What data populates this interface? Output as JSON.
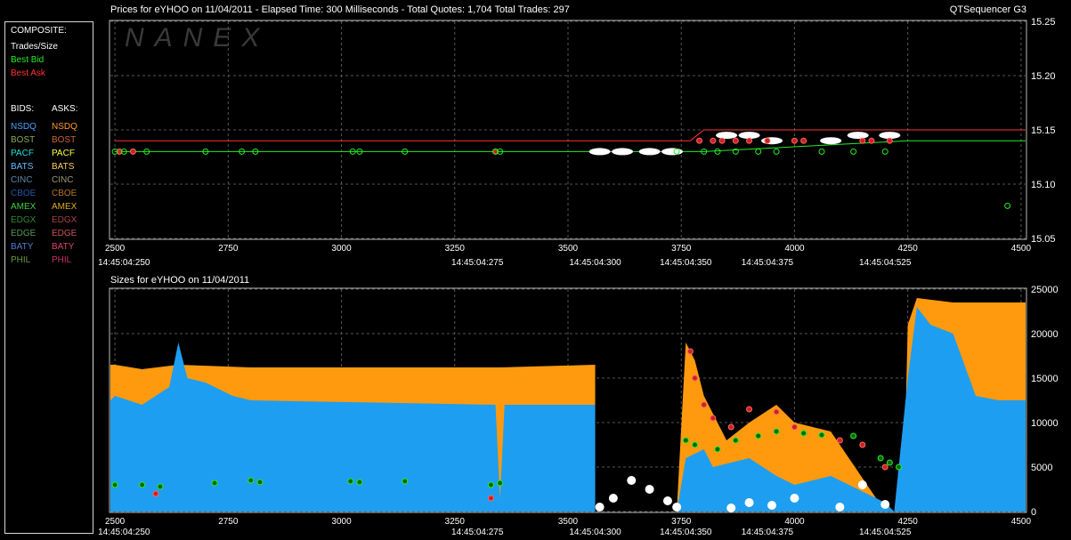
{
  "header": {
    "prices_title": "Prices for  eYHOO  on  11/04/2011  -  Elapsed Time: 300 Milliseconds  -  Total Quotes: 1,704  Total Trades: 297",
    "app_name": "QTSequencer G3",
    "sizes_title": "Sizes for  eYHOO  on  11/04/2011",
    "watermark": "NANEX"
  },
  "legend": {
    "composite_label": "COMPOSITE:",
    "composite_items": [
      {
        "label": "Trades/Size",
        "color": "#ffffff"
      },
      {
        "label": "Best Bid",
        "color": "#22ee22"
      },
      {
        "label": "Best Ask",
        "color": "#ff3333"
      }
    ],
    "bids_label": "BIDS:",
    "asks_label": "ASKS:",
    "exchanges": [
      {
        "label": "NSDQ",
        "bid_color": "#4aa0ff",
        "ask_color": "#ff9a30"
      },
      {
        "label": "BOST",
        "bid_color": "#88aa55",
        "ask_color": "#cc6633"
      },
      {
        "label": "PACF",
        "bid_color": "#22dddd",
        "ask_color": "#ffff44"
      },
      {
        "label": "BATS",
        "bid_color": "#66bbff",
        "ask_color": "#ffcc66"
      },
      {
        "label": "CINC",
        "bid_color": "#5a8aaa",
        "ask_color": "#999977"
      },
      {
        "label": "CBOE",
        "bid_color": "#2255aa",
        "ask_color": "#bb7722"
      },
      {
        "label": "AMEX",
        "bid_color": "#44cc44",
        "ask_color": "#ddaa22"
      },
      {
        "label": "EDGX",
        "bid_color": "#338833",
        "ask_color": "#aa4444"
      },
      {
        "label": "EDGE",
        "bid_color": "#559955",
        "ask_color": "#cc5555"
      },
      {
        "label": "BATY",
        "bid_color": "#5577cc",
        "ask_color": "#dd4466"
      },
      {
        "label": "PHIL",
        "bid_color": "#669944",
        "ask_color": "#cc3366"
      }
    ]
  },
  "chart_data": [
    {
      "type": "scatter",
      "title": "Prices for  eYHOO  on  11/04/2011",
      "x_ticks": [
        2500,
        2750,
        3000,
        3250,
        3500,
        3750,
        4000,
        4250,
        4500
      ],
      "x_range": [
        2490,
        4510
      ],
      "y_ticks": [
        "15.05",
        "15.10",
        "15.15",
        "15.20",
        "15.25"
      ],
      "y_range": [
        15.05,
        15.25
      ],
      "time_labels": [
        {
          "x": 2520,
          "label": "14:45:04:250"
        },
        {
          "x": 3300,
          "label": "14:45:04:275"
        },
        {
          "x": 3560,
          "label": "14:45:04:300"
        },
        {
          "x": 3760,
          "label": "14:45:04:350"
        },
        {
          "x": 3940,
          "label": "14:45:04:375"
        },
        {
          "x": 4200,
          "label": "14:45:04:525"
        }
      ],
      "series": [
        {
          "name": "Best Bid",
          "color": "#22ee22",
          "points": [
            [
              2500,
              15.13
            ],
            [
              3560,
              15.13
            ],
            [
              3560,
              15.13
            ],
            [
              3800,
              15.13
            ],
            [
              4250,
              15.14
            ],
            [
              4510,
              15.14
            ]
          ]
        },
        {
          "name": "Best Ask",
          "color": "#ff3333",
          "points": [
            [
              2500,
              15.14
            ],
            [
              3770,
              15.14
            ],
            [
              3800,
              15.15
            ],
            [
              4250,
              15.15
            ],
            [
              4510,
              15.15
            ]
          ]
        },
        {
          "name": "Trades/Size",
          "color": "#ffffff",
          "points": [
            [
              3570,
              15.13
            ],
            [
              3620,
              15.13
            ],
            [
              3680,
              15.13
            ],
            [
              3730,
              15.13
            ],
            [
              3850,
              15.145
            ],
            [
              3900,
              15.145
            ],
            [
              3950,
              15.14
            ],
            [
              4080,
              15.14
            ],
            [
              4140,
              15.145
            ],
            [
              4210,
              15.145
            ]
          ]
        }
      ],
      "bid_markers": [
        [
          2500,
          15.13
        ],
        [
          2520,
          15.13
        ],
        [
          2570,
          15.13
        ],
        [
          2700,
          15.13
        ],
        [
          2780,
          15.13
        ],
        [
          2810,
          15.13
        ],
        [
          3025,
          15.13
        ],
        [
          3040,
          15.13
        ],
        [
          3140,
          15.13
        ],
        [
          3340,
          15.13
        ],
        [
          3350,
          15.13
        ],
        [
          3740,
          15.13
        ],
        [
          3800,
          15.13
        ],
        [
          3830,
          15.13
        ],
        [
          3870,
          15.13
        ],
        [
          3920,
          15.13
        ],
        [
          3960,
          15.13
        ],
        [
          4060,
          15.13
        ],
        [
          4130,
          15.13
        ],
        [
          4200,
          15.13
        ],
        [
          4470,
          15.08
        ]
      ],
      "ask_markers": [
        [
          2510,
          15.13
        ],
        [
          2540,
          15.13
        ],
        [
          3340,
          15.13
        ],
        [
          3790,
          15.14
        ],
        [
          3820,
          15.14
        ],
        [
          3840,
          15.14
        ],
        [
          3870,
          15.14
        ],
        [
          3900,
          15.14
        ],
        [
          3940,
          15.14
        ],
        [
          4000,
          15.14
        ],
        [
          4020,
          15.14
        ],
        [
          4150,
          15.14
        ],
        [
          4170,
          15.14
        ],
        [
          4210,
          15.14
        ]
      ]
    },
    {
      "type": "area",
      "title": "Sizes for  eYHOO  on  11/04/2011",
      "x_ticks": [
        2500,
        2750,
        3000,
        3250,
        3500,
        3750,
        4000,
        4250,
        4500
      ],
      "x_range": [
        2490,
        4510
      ],
      "y_ticks": [
        0,
        5000,
        10000,
        15000,
        20000,
        25000
      ],
      "y_range": [
        0,
        25000
      ],
      "series": [
        {
          "name": "NSDQ",
          "color": "#1e9ef0",
          "points": [
            [
              2490,
              12500
            ],
            [
              2500,
              13000
            ],
            [
              2560,
              12000
            ],
            [
              2620,
              14000
            ],
            [
              2640,
              19000
            ],
            [
              2660,
              15000
            ],
            [
              2700,
              14500
            ],
            [
              2760,
              13000
            ],
            [
              2800,
              12500
            ],
            [
              3340,
              12000
            ],
            [
              3350,
              1500
            ],
            [
              3360,
              12000
            ],
            [
              3560,
              12000
            ],
            [
              3560,
              0
            ],
            [
              3740,
              0
            ],
            [
              3760,
              6000
            ],
            [
              3800,
              7000
            ],
            [
              3820,
              5000
            ],
            [
              3900,
              6000
            ],
            [
              3960,
              4000
            ],
            [
              4000,
              3000
            ],
            [
              4080,
              4000
            ],
            [
              4200,
              1000
            ],
            [
              4220,
              0
            ],
            [
              4250,
              15000
            ],
            [
              4270,
              23000
            ],
            [
              4300,
              21000
            ],
            [
              4350,
              20000
            ],
            [
              4400,
              13000
            ],
            [
              4450,
              12500
            ],
            [
              4510,
              12500
            ]
          ]
        },
        {
          "name": "NSDQ ask",
          "color": "#ff9a0f",
          "points": [
            [
              2490,
              16500
            ],
            [
              2500,
              16500
            ],
            [
              2560,
              16000
            ],
            [
              2640,
              16500
            ],
            [
              2800,
              16200
            ],
            [
              3330,
              16200
            ],
            [
              3350,
              16200
            ],
            [
              3560,
              16500
            ],
            [
              3560,
              0
            ],
            [
              3740,
              0
            ],
            [
              3760,
              19000
            ],
            [
              3780,
              17000
            ],
            [
              3800,
              13000
            ],
            [
              3830,
              10000
            ],
            [
              3850,
              8000
            ],
            [
              3900,
              10000
            ],
            [
              3960,
              12000
            ],
            [
              4000,
              10000
            ],
            [
              4080,
              9000
            ],
            [
              4200,
              0
            ],
            [
              4240,
              0
            ],
            [
              4250,
              21000
            ],
            [
              4270,
              24000
            ],
            [
              4350,
              23500
            ],
            [
              4500,
              23500
            ],
            [
              4510,
              23500
            ]
          ]
        }
      ],
      "trade_markers": [
        [
          3570,
          500
        ],
        [
          3600,
          1500
        ],
        [
          3640,
          3500
        ],
        [
          3680,
          2500
        ],
        [
          3720,
          1200
        ],
        [
          3740,
          500
        ],
        [
          3860,
          400
        ],
        [
          3900,
          1000
        ],
        [
          3950,
          700
        ],
        [
          4000,
          1500
        ],
        [
          4100,
          500
        ],
        [
          4150,
          3000
        ],
        [
          4200,
          800
        ]
      ],
      "ask_markers": [
        [
          2590,
          2000
        ],
        [
          3330,
          1500
        ],
        [
          3770,
          18000
        ],
        [
          3780,
          15000
        ],
        [
          3800,
          12000
        ],
        [
          3820,
          10500
        ],
        [
          3860,
          9500
        ],
        [
          3900,
          11500
        ],
        [
          3960,
          11200
        ],
        [
          4000,
          9500
        ],
        [
          4100,
          8000
        ],
        [
          4150,
          7500
        ],
        [
          4200,
          5000
        ]
      ],
      "bid_markers": [
        [
          2500,
          3000
        ],
        [
          2560,
          3000
        ],
        [
          2600,
          2800
        ],
        [
          2720,
          3200
        ],
        [
          2800,
          3500
        ],
        [
          2820,
          3300
        ],
        [
          3020,
          3400
        ],
        [
          3040,
          3300
        ],
        [
          3140,
          3400
        ],
        [
          3330,
          3000
        ],
        [
          3350,
          3200
        ],
        [
          3760,
          8000
        ],
        [
          3780,
          7500
        ],
        [
          3830,
          7000
        ],
        [
          3870,
          8000
        ],
        [
          3920,
          8500
        ],
        [
          3960,
          9000
        ],
        [
          4020,
          8800
        ],
        [
          4060,
          8600
        ],
        [
          4130,
          8500
        ],
        [
          4190,
          6000
        ],
        [
          4210,
          5500
        ],
        [
          4230,
          5000
        ]
      ]
    }
  ]
}
